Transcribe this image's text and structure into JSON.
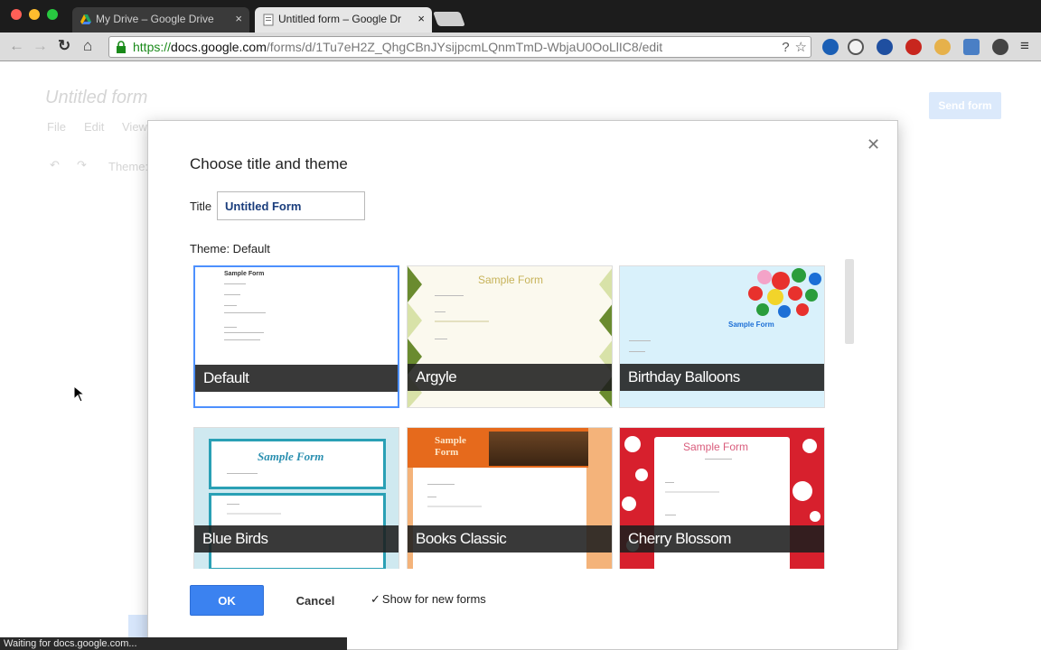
{
  "browser": {
    "tabs": [
      {
        "title": "My Drive – Google Drive",
        "active": false,
        "icon": "google-drive-icon"
      },
      {
        "title": "Untitled form – Google Dr",
        "active": true,
        "icon": "google-forms-icon"
      }
    ],
    "url": {
      "scheme": "https://",
      "host": "docs.google.com",
      "path": "/forms/d/1Tu7eH2Z_QhgCBnJYsijpcmLQnmTmD-WbjaU0OoLlIC8/edit"
    },
    "status": "Waiting for docs.google.com..."
  },
  "background": {
    "doc_title": "Untitled form",
    "menu": [
      "File",
      "Edit",
      "View"
    ],
    "toolbar_label": "Theme:",
    "send_button": "Send form"
  },
  "dialog": {
    "heading": "Choose title and theme",
    "title_label": "Title",
    "title_value": "Untitled Form",
    "theme_label": "Theme: Default",
    "themes": [
      {
        "name": "Default",
        "selected": true,
        "sample": "Sample Form"
      },
      {
        "name": "Argyle",
        "selected": false,
        "sample": "Sample Form"
      },
      {
        "name": "Birthday Balloons",
        "selected": false,
        "sample": "Sample Form"
      },
      {
        "name": "Blue Birds",
        "selected": false,
        "sample": "Sample Form"
      },
      {
        "name": "Books Classic",
        "selected": false,
        "sample": "Sample Form"
      },
      {
        "name": "Cherry Blossom",
        "selected": false,
        "sample": "Sample Form"
      }
    ],
    "ok_label": "OK",
    "cancel_label": "Cancel",
    "show_new_forms_label": "Show for new forms",
    "show_new_forms_checked": true
  },
  "colors": {
    "accent_blue": "#3b82f0",
    "selection_border": "#4d90fe",
    "https_green": "#1a8a1a"
  }
}
